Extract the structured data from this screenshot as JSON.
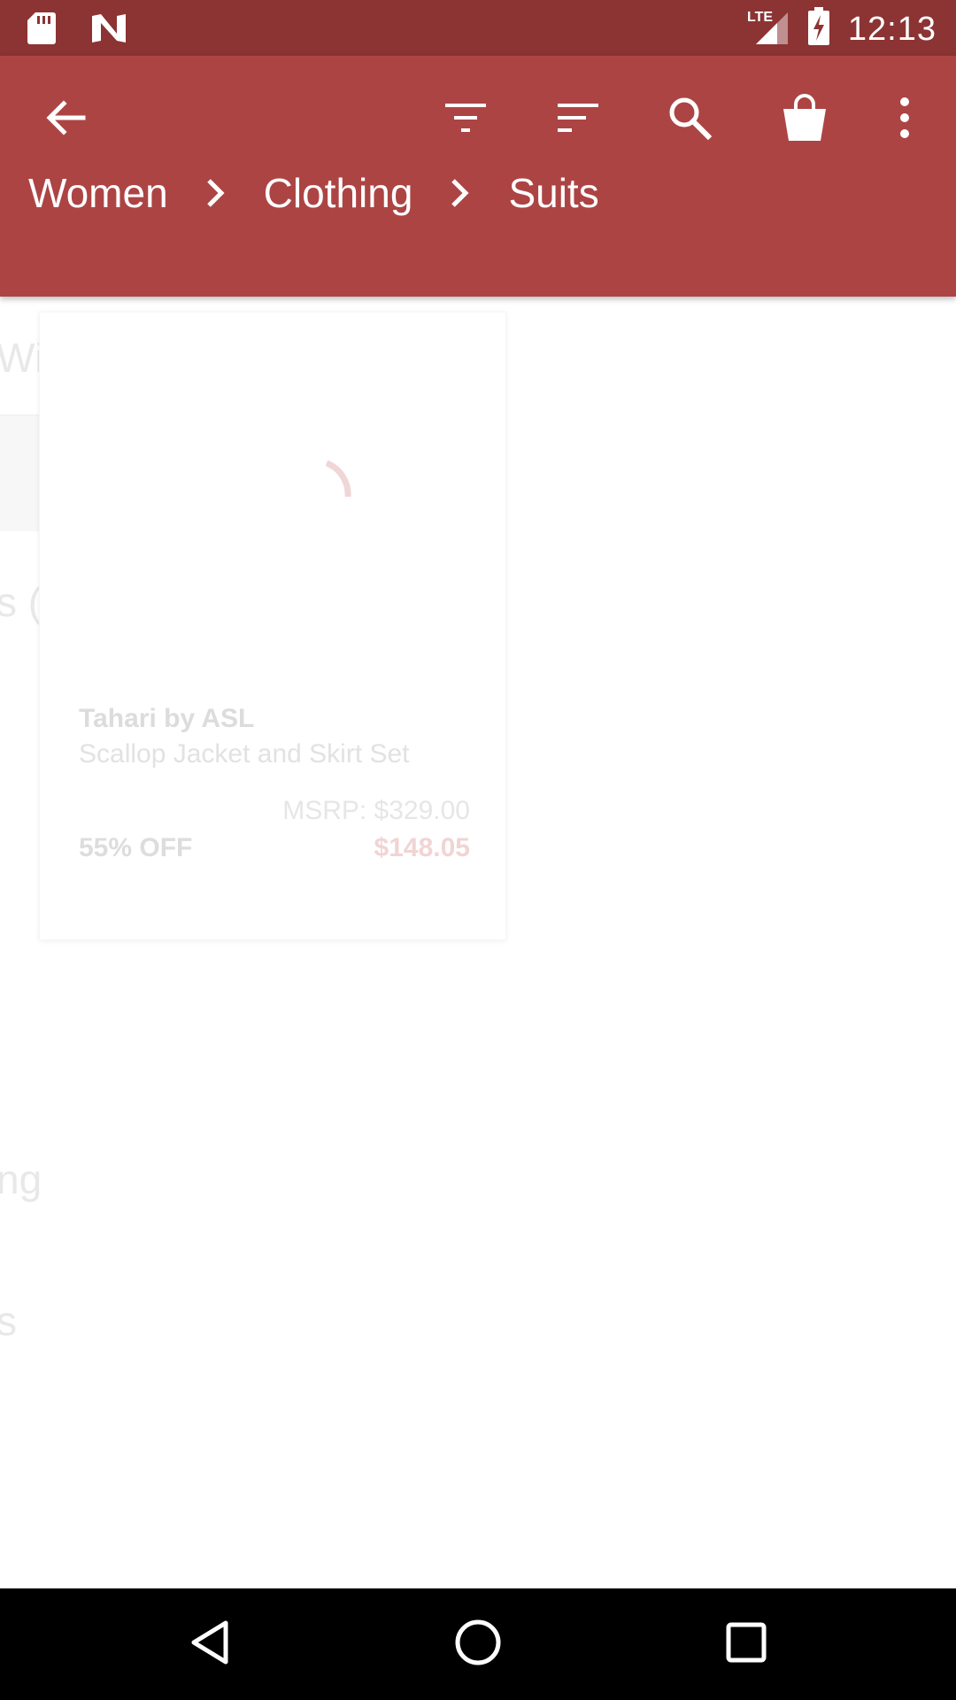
{
  "status_bar": {
    "time": "12:13",
    "network": "LTE",
    "icons": [
      "sd-card-icon",
      "n-logo-icon",
      "lte-signal-icon",
      "battery-charging-icon"
    ]
  },
  "app_bar": {
    "background_color": "#ad4444",
    "actions": [
      "back-arrow-icon",
      "filter-icon",
      "sort-icon",
      "search-icon",
      "shopping-bag-icon",
      "more-vert-icon"
    ],
    "breadcrumb": {
      "items": [
        "Women",
        "Clothing",
        "Suits"
      ]
    }
  },
  "background_sheet": {
    "fragments": [
      "Wi",
      "s (",
      "ng",
      "s"
    ]
  },
  "product_card": {
    "brand": "Tahari by ASL",
    "name": "Scallop Jacket and Skirt Set",
    "msrp": "MSRP: $329.00",
    "discount": "55% OFF",
    "price": "$148.05",
    "image_loading": true
  },
  "nav_bar": {
    "buttons": [
      "back-triangle-icon",
      "home-circle-icon",
      "recents-square-icon"
    ]
  }
}
